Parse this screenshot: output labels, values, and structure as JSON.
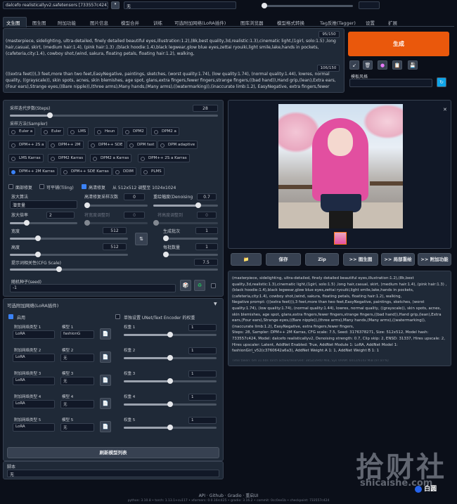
{
  "top": {
    "checkpoint": "dalcefo realisticallyv2.safetensors [733557c424]",
    "vae": "无"
  },
  "tabs": [
    "文生图",
    "图生图",
    "附加功能",
    "图片信息",
    "模型合并",
    "训练",
    "可选附加网络(LoRA插件)",
    "图库浏览器",
    "模型格式转换",
    "Tag反推(Tagger)",
    "设置",
    "扩展"
  ],
  "prompt": {
    "text": "(masterpiece, sidelighting, ultra-detailed, finely detailed beautiful eyes,illustration:1.2),(8k,best quality,3d,realistic:1.3),cinematic light,(1girl, solo:1.5) ,long hair,casual, skirt, (medium hair:1.4), (pink hair:1.3) ,(black hoodie:1.4),black legwear,glow blue eyes,zettai ryouiki,light smile,lake,hands in pockets,(cafeteria,city:1.4), cowboy shot,(wind, sakura, floating petals, floating hair:1.2), walking,",
    "counter": "95/150"
  },
  "negative": {
    "text": "(((extra feet))),3 feet,more than two feet,EasyNegative, paintings, sketches, (worst quality:1.74), (low quality:1.74), (normal quality:1.44), lowres, normal quality, ((grayscale)), skin spots, acnes, skin blemishes, age spot, glans,extra fingers,fewer fingers,strange fingers,((bad hand)),Hand grip,(lean),Extra ears,(Four ears),Strange eyes,((Bare nipple)),(three arms),Many hands,(Many arms),((watermarking)),(inaccurate limb:1.2), EasyNegative, extra fingers,fewer fingers,",
    "counter": "106/150"
  },
  "generate_label": "生成",
  "style_label": "模板风格",
  "steps": {
    "label": "采样迭代步数(Steps)",
    "value": "28",
    "fraction": 0.19
  },
  "sampler": {
    "label": "采样方法(Sampler)",
    "options": [
      "Euler a",
      "Euler",
      "LMS",
      "Heun",
      "DPM2",
      "DPM2 a",
      "DPM++ 2S a",
      "DPM++ 2M",
      "DPM++ SDE",
      "DPM fast",
      "DPM adaptive",
      "LMS Karras",
      "DPM2 Karras",
      "DPM2 a Karras",
      "DPM++ 2S a Karras",
      "DPM++ 2M Karras",
      "DPM++ SDE Karras",
      "DDIM",
      "PLMS"
    ],
    "selected": "DPM++ 2M Karras"
  },
  "checks": {
    "face": "面部修复",
    "tiling": "可平铺(Tiling)",
    "hires": "高清修复",
    "hires_info": "从 512x512 调整至 1024x1024"
  },
  "upscaler": {
    "label": "放大算法",
    "value": "潜变量"
  },
  "hires_steps": {
    "label": "高清修复采样次数",
    "value": "0"
  },
  "denoise": {
    "label": "重绘幅度(Denoising",
    "value": "0.7"
  },
  "upscale_by": {
    "label": "放大倍率",
    "value": "2"
  },
  "resize_w": {
    "label": "将宽度调整到",
    "value": "0"
  },
  "resize_h": {
    "label": "将高度调整到",
    "value": "0"
  },
  "width": {
    "label": "宽度",
    "value": "512"
  },
  "height": {
    "label": "高度",
    "value": "512"
  },
  "batch_count": {
    "label": "生成批次",
    "value": "1"
  },
  "batch_size": {
    "label": "每批数量",
    "value": "1"
  },
  "cfg": {
    "label": "提示词相关性(CFG Scale)",
    "value": "7.5"
  },
  "seed": {
    "label": "随机种子(seed)",
    "value": "-1"
  },
  "lora": {
    "header": "可选附加网络(LoRA插件)",
    "enable": "启用",
    "separate": "单独设置 UNet/Text Encoder 的权重",
    "rows": [
      {
        "type_label": "附加网络类型 1",
        "type": "LoRA",
        "model_label": "模型 1",
        "model": "fashionG",
        "weight_label": "权重 1",
        "weight": "1"
      },
      {
        "type_label": "附加网络类型 2",
        "type": "LoRA",
        "model_label": "模型 2",
        "model": "无",
        "weight_label": "权重 2",
        "weight": "1"
      },
      {
        "type_label": "附加网络类型 3",
        "type": "LoRA",
        "model_label": "模型 3",
        "model": "无",
        "weight_label": "权重 3",
        "weight": "1"
      },
      {
        "type_label": "附加网络类型 4",
        "type": "LoRA",
        "model_label": "模型 4",
        "model": "无",
        "weight_label": "权重 4",
        "weight": "1"
      },
      {
        "type_label": "附加网络类型 5",
        "type": "LoRA",
        "model_label": "模型 5",
        "model": "无",
        "weight_label": "权重 5",
        "weight": "1"
      }
    ],
    "refresh": "刷新模型列表"
  },
  "script": {
    "label": "脚本",
    "value": "无"
  },
  "actions": {
    "folder": "📁",
    "save": "保存",
    "zip": "Zip",
    "to_img2img": ">> 图生图",
    "to_inpaint": ">> 局部重绘",
    "to_extras": ">> 附加功能"
  },
  "info": {
    "text": "(masterpiece, sidelighting, ultra-detailed, finely detailed beautiful eyes,illustration:1.2),(8k,best quality,3d,realistic:1.3),cinematic light,(1girl, solo:1.5) ,long hair,casual, skirt, (medium hair:1.4), (pink hair:1.3) ,(black hoodie:1.4),black legwear,glow blue eyes,zettai ryouiki,light smile,lake,hands in pockets,(cafeteria,city:1.4), cowboy shot,(wind, sakura, floating petals, floating hair:1.2), walking,\nNegative prompt: (((extra feet))),3 feet,more than two feet,EasyNegative, paintings, sketches, (worst quality:1.74), (low quality:1.74), (normal quality:1.44), lowres, normal quality, ((grayscale)), skin spots, acnes, skin blemishes, age spot, glans,extra fingers,fewer fingers,strange fingers,((bad hand)),Hand grip,(lean),Extra ears,(Four ears),Strange eyes,((Bare nipple)),(three arms),Many hands,(Many arms),((watermarking)),(inaccurate limb:1.2), EasyNegative, extra fingers,fewer fingers,\nSteps: 28, Sampler: DPM++ 2M Karras, CFG scale: 7.5, Seed: 3176378271, Size: 512x512, Model hash: 733557c424, Model: dalcefo realisticallyv2, Denoising strength: 0.7, Clip skip: 2, ENSD: 31337, Hires upscale: 2, Hires upscaler: Latent, AddNet Enabled: True, AddNet Module 1: LoRA, AddNet Model 1: fashionGirl_v52(c3760642a6a3), AddNet Weight A 1: 1, AddNet Weight B 1: 1",
    "time": "Time taken: 6m 31.60s  Torch active/reserved: 3852/3940 MiB, Sys VRAM: 6012/6143 MiB (97.87%)"
  },
  "footer": {
    "links": "API · Github · Gradio · 重启UI",
    "versions": "python: 3.10.8  •  torch: 1.13.1+cu117  •  xformers: 0.0.16rc425  •  gradio: 3.16.2  •  commit: 0cc0ee1b  •  checkpoint: 733557c424"
  },
  "watermark": {
    "big": "拾财社",
    "small": "shicaishe.com",
    "badge": "白圆"
  }
}
